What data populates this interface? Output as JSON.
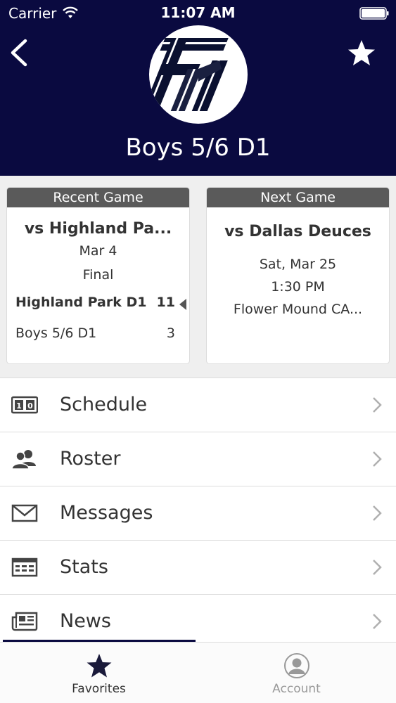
{
  "status_bar": {
    "carrier": "Carrier",
    "time": "11:07 AM"
  },
  "header": {
    "title": "Boys 5/6 D1",
    "logo_text": "FM"
  },
  "recent_game": {
    "header": "Recent Game",
    "opponent": "vs Highland Pa...",
    "date": "Mar 4",
    "status": "Final",
    "scores": [
      {
        "team": "Highland Park D1",
        "score": "11"
      },
      {
        "team": "Boys 5/6 D1",
        "score": "3"
      }
    ]
  },
  "next_game": {
    "header": "Next Game",
    "opponent": "vs Dallas Deuces",
    "date": "Sat, Mar 25",
    "time": "1:30 PM",
    "location": "Flower Mound CA..."
  },
  "menu": {
    "items": [
      {
        "label": "Schedule",
        "icon": "scoreboard-icon"
      },
      {
        "label": "Roster",
        "icon": "people-icon"
      },
      {
        "label": "Messages",
        "icon": "envelope-icon"
      },
      {
        "label": "Stats",
        "icon": "stats-table-icon"
      },
      {
        "label": "News",
        "icon": "newspaper-icon"
      }
    ]
  },
  "tabbar": {
    "favorites_label": "Favorites",
    "account_label": "Account"
  },
  "colors": {
    "header_bg": "#0a0a40",
    "card_header_bg": "#5a5a5a",
    "accent": "#0a0a40"
  }
}
